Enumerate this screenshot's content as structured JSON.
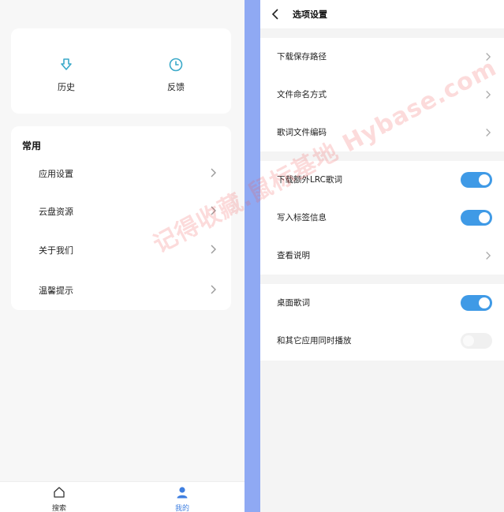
{
  "left": {
    "quick_actions": [
      {
        "label": "历史",
        "icon": "download-arrow-icon"
      },
      {
        "label": "反馈",
        "icon": "clock-icon"
      }
    ],
    "section_title": "常用",
    "menu": [
      {
        "label": "应用设置"
      },
      {
        "label": "云盘资源"
      },
      {
        "label": "关于我们"
      },
      {
        "label": "温馨提示"
      }
    ],
    "tabbar": [
      {
        "label": "搜索",
        "icon": "home-icon",
        "active": false
      },
      {
        "label": "我的",
        "icon": "user-icon",
        "active": true
      }
    ]
  },
  "right": {
    "title": "选项设置",
    "group1": [
      {
        "label": "下载保存路径"
      },
      {
        "label": "文件命名方式"
      },
      {
        "label": "歌词文件编码"
      }
    ],
    "group2": [
      {
        "label": "下载额外LRC歌词",
        "toggle": true
      },
      {
        "label": "写入标签信息",
        "toggle": true
      },
      {
        "label": "查看说明"
      }
    ],
    "group3": [
      {
        "label": "桌面歌词",
        "toggle": true
      },
      {
        "label": "和其它应用同时播放",
        "toggle": false
      }
    ]
  },
  "watermark": "记得收藏.鼠标基地 Hybase.com",
  "colors": {
    "accent": "#3f9ae6",
    "strip": "#8fa9f3",
    "tab_active": "#3f7fe0"
  }
}
